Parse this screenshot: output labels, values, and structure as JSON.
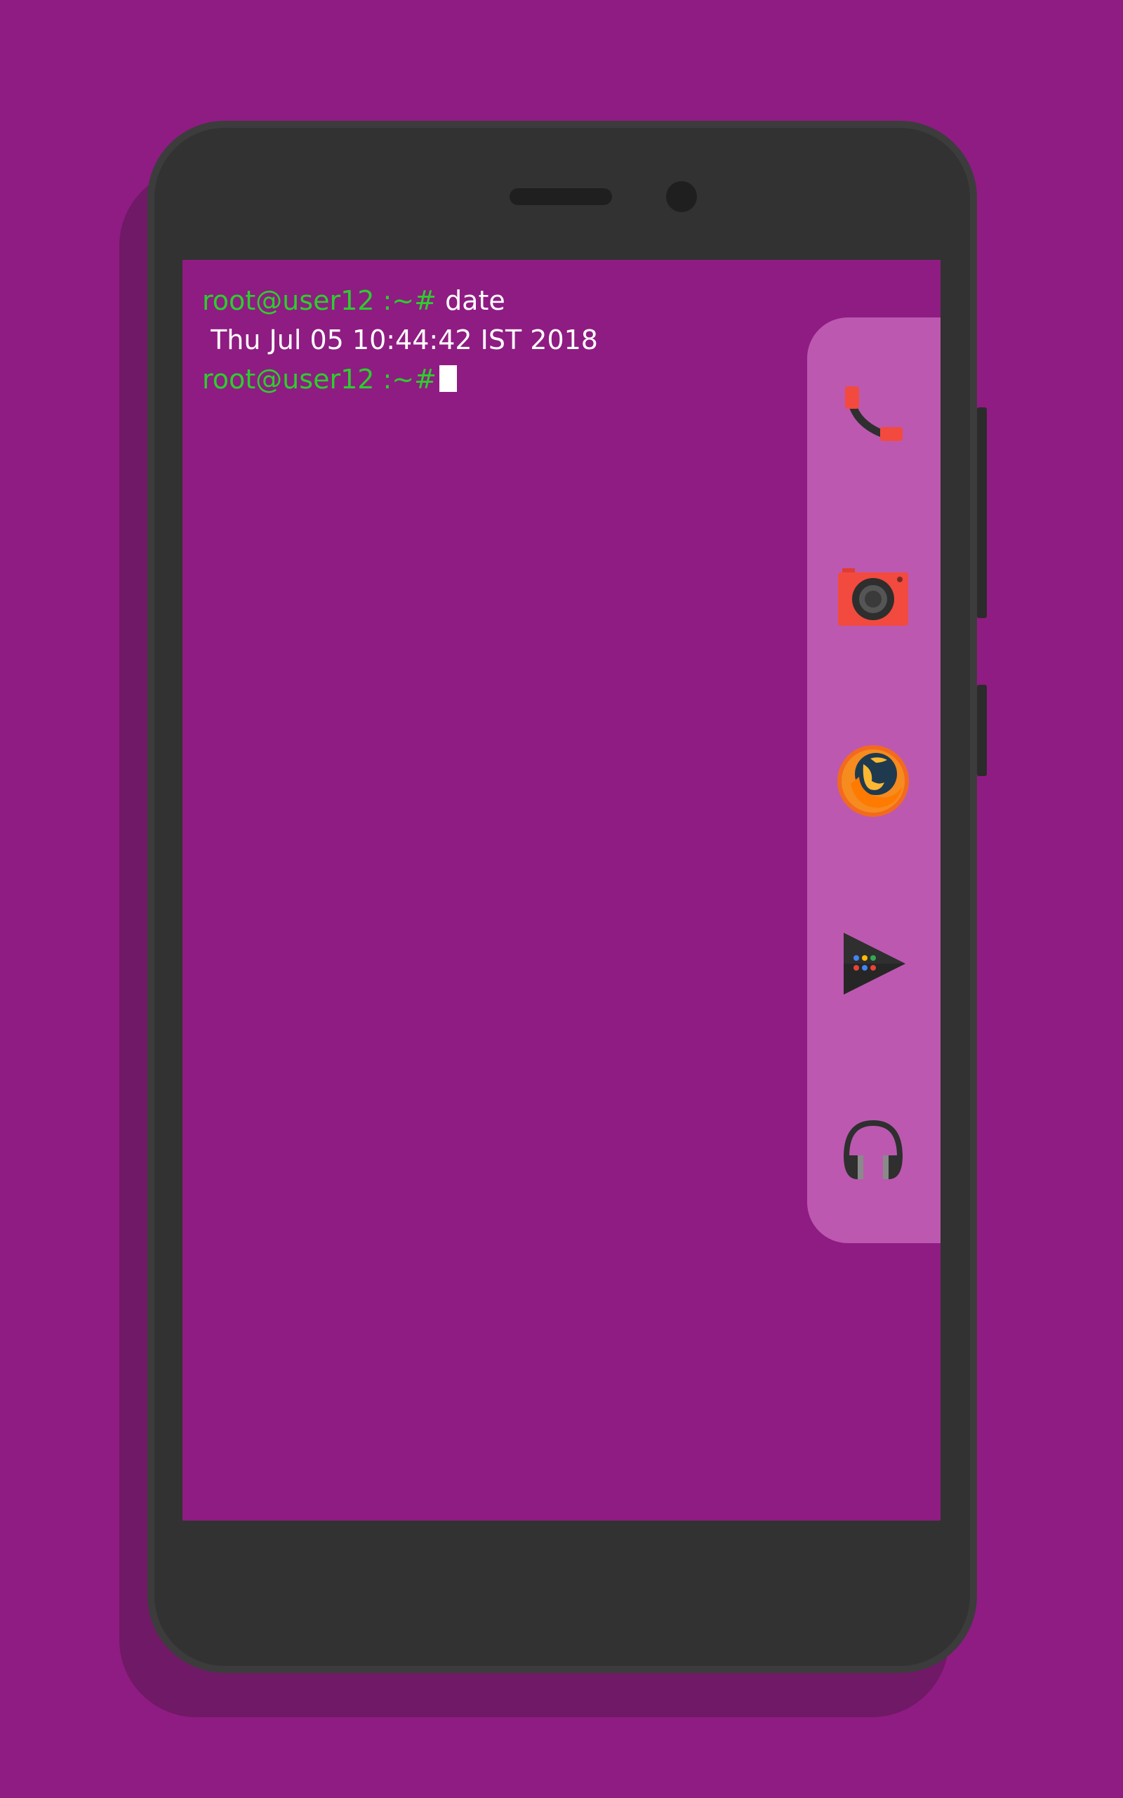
{
  "terminal": {
    "line1_prompt": "root@user12 :~#",
    "line1_command": " date",
    "line2_output": " Thu Jul 05 10:44:42 IST 2018",
    "line3_prompt": "root@user12 :~#"
  },
  "dock": {
    "items": [
      {
        "icon": "phone-icon"
      },
      {
        "icon": "camera-icon"
      },
      {
        "icon": "firefox-icon"
      },
      {
        "icon": "play-store-icon"
      },
      {
        "icon": "headphones-icon"
      }
    ]
  },
  "colors": {
    "background": "#8f1c82",
    "phone_body": "#323232",
    "dock": "#bc58b0",
    "prompt_green": "#2bcf2b",
    "text_white": "#ffffff"
  }
}
